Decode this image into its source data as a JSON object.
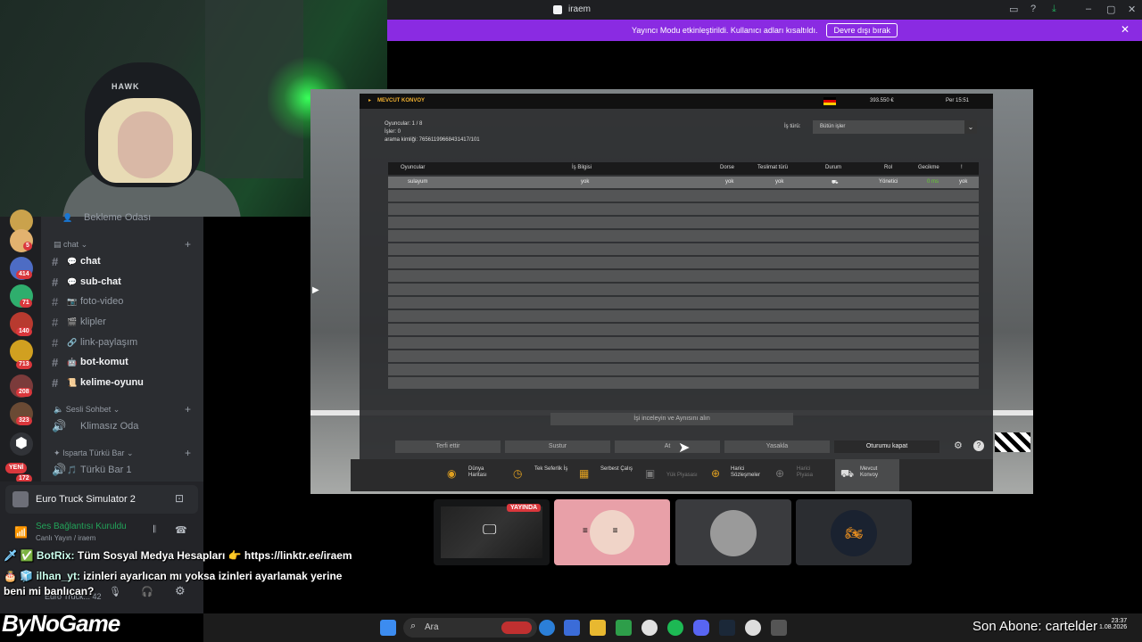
{
  "webcam": {
    "cap_text": "HAWK"
  },
  "titlebar": {
    "title": "iraem"
  },
  "notice": {
    "message": "Yayıncı Modu etkinleştirildi. Kullanıcı adları kısaltıldı.",
    "button": "Devre dışı bırak"
  },
  "servers": {
    "badges": [
      "5",
      "414",
      "71",
      "140",
      "713",
      "208",
      "323",
      "172"
    ],
    "new_label": "YENİ"
  },
  "channels": {
    "top_partial": "Bekleme Odası",
    "categories": [
      "chat",
      "Sesli Sohbet",
      "Isparta Türkü Bar"
    ],
    "items": [
      {
        "name": "chat",
        "emoji": "💬",
        "unread": true
      },
      {
        "name": "sub-chat",
        "emoji": "💬",
        "unread": true
      },
      {
        "name": "foto-video",
        "emoji": "📷",
        "unread": false
      },
      {
        "name": "klipler",
        "emoji": "🎬",
        "unread": false
      },
      {
        "name": "link-paylaşım",
        "emoji": "🔗",
        "unread": false
      },
      {
        "name": "bot-komut",
        "emoji": "🤖",
        "unread": true
      },
      {
        "name": "kelime-oyunu",
        "emoji": "📜",
        "unread": true
      }
    ],
    "voice": [
      "Klimasız Oda",
      "Türkü Bar 1"
    ]
  },
  "activity": {
    "game": "Euro Truck Simulator 2",
    "voice_status": "Ses Bağlantısı Kuruldu",
    "voice_sub": "Canlı Yayın / iraem",
    "user_partial": "Euro Truck... 42"
  },
  "game": {
    "header_title": "MEVCUT KONVOY",
    "money": "393.550 €",
    "time": "Per 15:51",
    "players": "Oyuncular: 1 / 8",
    "jobs": "İşler: 0",
    "search_id": "arama kimliği: 76561199668431417/101",
    "filter_label": "İş türü:",
    "filter_value": "Bütün işler",
    "columns": [
      "Oyuncular",
      "İş Bilgisi",
      "Dorse",
      "Teslimat türü",
      "Durum",
      "Rol",
      "Gecikme",
      "!"
    ],
    "rows": [
      {
        "player": "sulayum",
        "job": "yok",
        "trailer": "yok",
        "delivery": "yok",
        "role": "Yönetici",
        "ping": "0 ms",
        "flag": "yok"
      }
    ],
    "inspect_button": "İşi inceleyin ve Aynısını alın",
    "action_buttons": [
      "Terfi ettir",
      "Sustur",
      "At",
      "Yasakla",
      "Oturumu kapat"
    ],
    "tabs": [
      "Dünya Haritası",
      "Tek Seferlik İş",
      "Serbest Çalış",
      "Yük Piyasası",
      "Harici Sözleşmeler",
      "Harici Piyasa",
      "Mevcut Konvoy"
    ]
  },
  "stream": {
    "live_badge": "YAYINDA"
  },
  "chat": [
    {
      "user": "BotRix:",
      "text": "Tüm Sosyal Medya Hesapları 👉 https://linktr.ee/iraem"
    },
    {
      "user": "ilhan_yt:",
      "text": "izinleri ayarlıcan mı yoksa izinleri ayarlamak yerine"
    },
    {
      "user": "",
      "text": "beni mi banlıcan?"
    }
  ],
  "overlay": {
    "logo": "ByNoGame",
    "sub_label": "Son Abone: cartelder",
    "time": "23:37",
    "date": "1.08.2026"
  },
  "taskbar": {
    "search_placeholder": "Ara"
  }
}
